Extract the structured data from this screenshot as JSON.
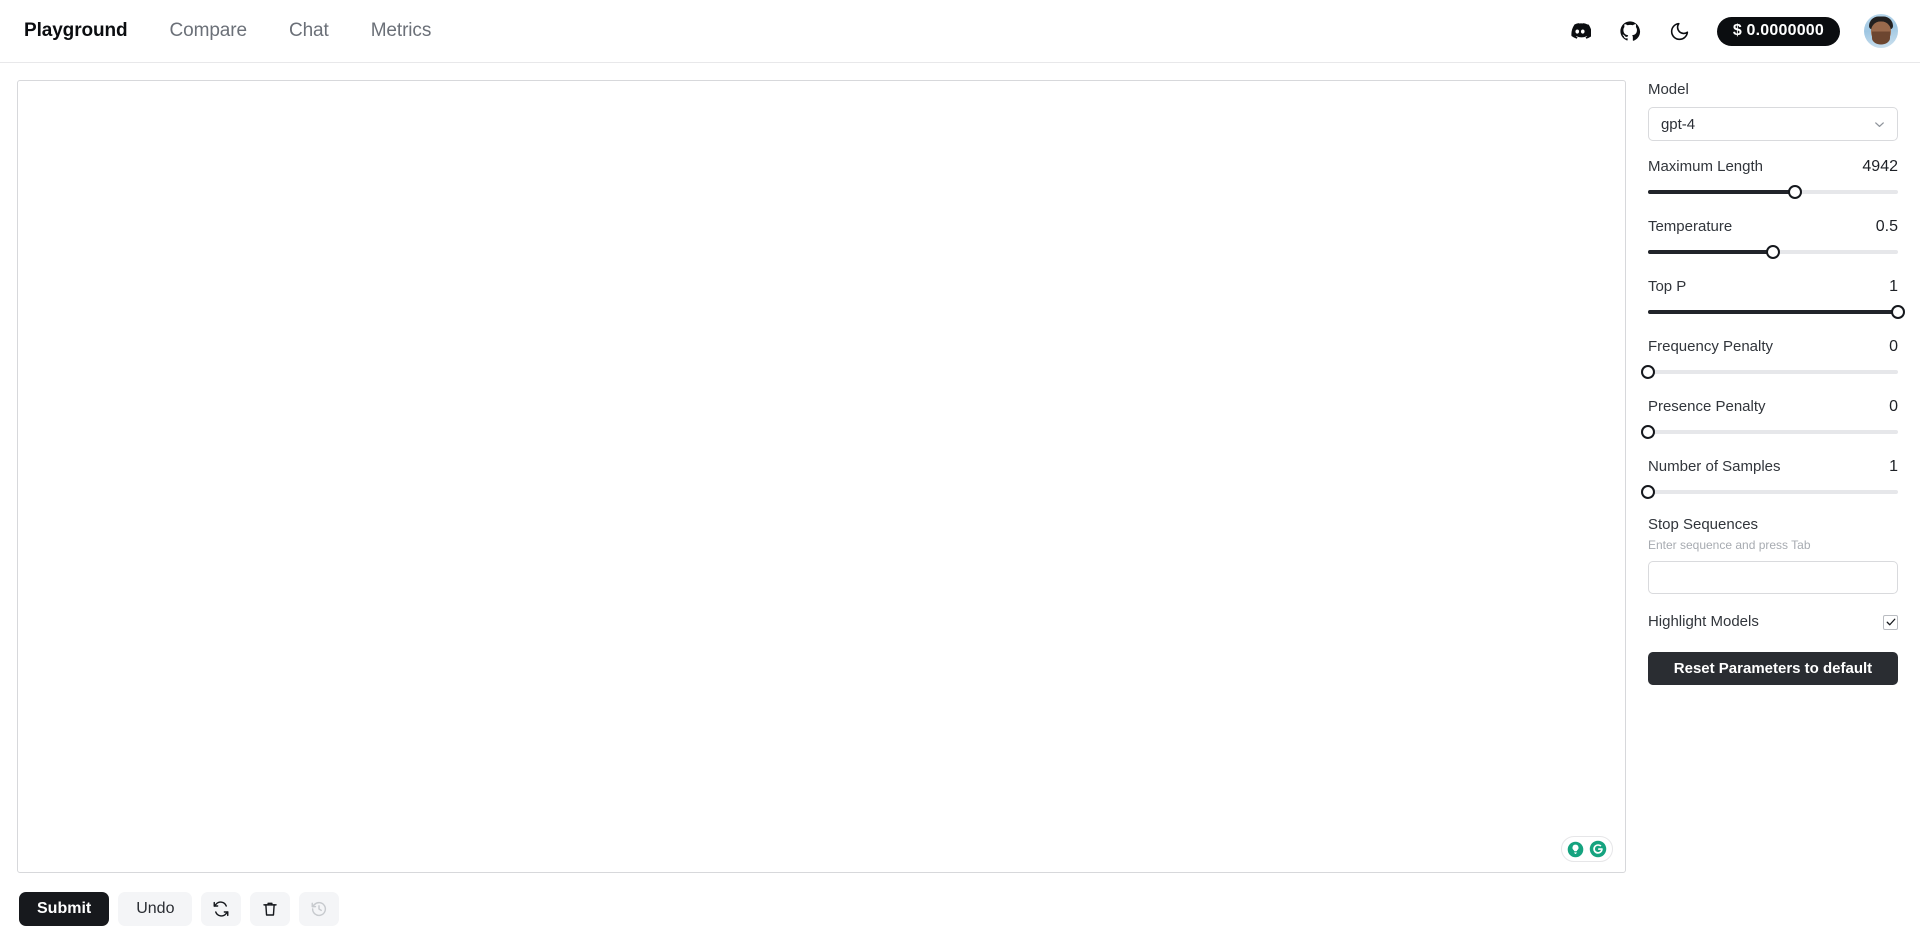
{
  "header": {
    "nav": [
      {
        "label": "Playground",
        "active": true
      },
      {
        "label": "Compare",
        "active": false
      },
      {
        "label": "Chat",
        "active": false
      },
      {
        "label": "Metrics",
        "active": false
      }
    ],
    "icons": [
      "discord-icon",
      "github-icon",
      "dark-mode-moon-icon"
    ],
    "cost_badge": "$ 0.0000000",
    "avatar_alt": "user-avatar"
  },
  "editor": {
    "content": "",
    "placeholder": "",
    "grammarly": {
      "bulb": "grammarly-suggestion-icon",
      "logo": "grammarly-logo-icon"
    }
  },
  "toolbar": {
    "submit_label": "Submit",
    "undo_label": "Undo",
    "regenerate_icon": "regenerate-icon",
    "delete_icon": "trash-icon",
    "history_icon": "history-icon"
  },
  "panel": {
    "model": {
      "label": "Model",
      "value": "gpt-4"
    },
    "params": [
      {
        "label": "Maximum Length",
        "value": "4942",
        "percent": 59
      },
      {
        "label": "Temperature",
        "value": "0.5",
        "percent": 50
      },
      {
        "label": "Top P",
        "value": "1",
        "percent": 100
      },
      {
        "label": "Frequency Penalty",
        "value": "0",
        "percent": 0
      },
      {
        "label": "Presence Penalty",
        "value": "0",
        "percent": 0
      },
      {
        "label": "Number of Samples",
        "value": "1",
        "percent": 0
      }
    ],
    "stop_sequences": {
      "label": "Stop Sequences",
      "hint": "Enter sequence and press Tab",
      "value": "",
      "placeholder": ""
    },
    "highlight_models": {
      "label": "Highlight Models",
      "checked": true
    },
    "reset_label": "Reset Parameters to default"
  },
  "colors": {
    "accent_dark": "#17191d",
    "grammarly_teal": "#15a37f",
    "track_fill": "#21242a",
    "track_bg": "#e6e7ea"
  }
}
